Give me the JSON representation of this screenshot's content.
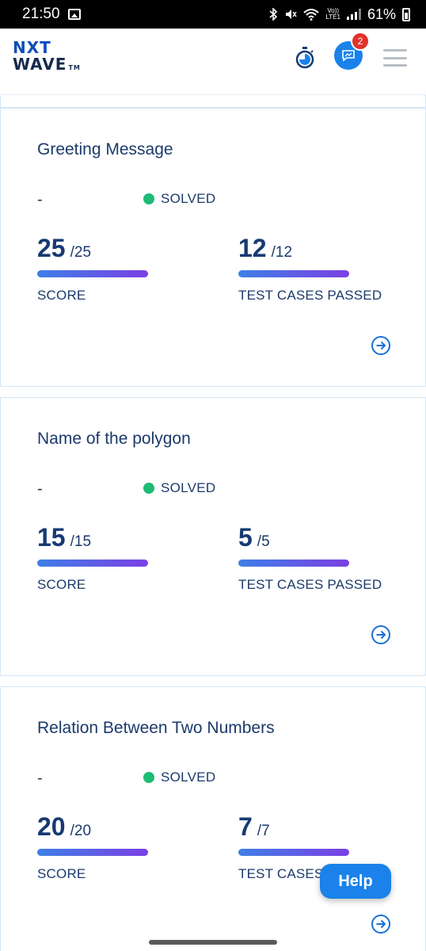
{
  "status_bar": {
    "time": "21:50",
    "battery": "61%",
    "icons": [
      "gallery-icon",
      "bluetooth-icon",
      "mute-icon",
      "wifi-icon",
      "volte-icon",
      "signal-icon",
      "battery-icon"
    ],
    "lte_line1": "Vo))",
    "lte_line2": "LTE1"
  },
  "header": {
    "logo_line1": "NXT",
    "logo_line2": "WAVE",
    "logo_tm": "TM",
    "notification_count": "2",
    "icons": [
      "stopwatch-icon",
      "chat-icon",
      "menu-icon"
    ],
    "accent_color": "#1a82ea"
  },
  "problems": [
    {
      "title": "Greeting Message",
      "language": "-",
      "status": "SOLVED",
      "score": "25",
      "score_total": "/25",
      "score_label": "SCORE",
      "tests": "12",
      "tests_total": "/12",
      "tests_label": "TEST CASES PASSED"
    },
    {
      "title": "Name of the polygon",
      "language": "-",
      "status": "SOLVED",
      "score": "15",
      "score_total": "/15",
      "score_label": "SCORE",
      "tests": "5",
      "tests_total": "/5",
      "tests_label": "TEST CASES PASSED"
    },
    {
      "title": "Relation Between Two Numbers",
      "language": "-",
      "status": "SOLVED",
      "score": "20",
      "score_total": "/20",
      "score_label": "SCORE",
      "tests": "7",
      "tests_total": "/7",
      "tests_label": "TEST CASES PASSED"
    }
  ],
  "help_button": "Help",
  "colors": {
    "solved_dot": "#1dbb74",
    "title_text": "#1b3a6b",
    "progress_start": "#3e7fe6",
    "progress_end": "#7b3fe4"
  }
}
